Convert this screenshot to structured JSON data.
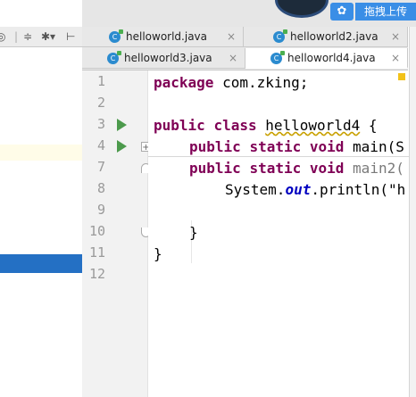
{
  "upload": {
    "label": "拖拽上传"
  },
  "tabs": {
    "row1": [
      {
        "label": "helloworld.java"
      },
      {
        "label": "helloworld2.java"
      }
    ],
    "row2": [
      {
        "label": "helloworld3.java"
      },
      {
        "label": "helloworld4.java",
        "active": true
      }
    ],
    "close_glyph": "×"
  },
  "code": {
    "lines": [
      {
        "number": "1",
        "tokens": [
          "package",
          " com.zking;"
        ]
      },
      {
        "number": "2",
        "tokens": []
      },
      {
        "number": "3",
        "tokens": [
          "public",
          " ",
          "class",
          " ",
          "helloworld4",
          " {"
        ]
      },
      {
        "number": "4",
        "tokens": [
          "public",
          " ",
          "static",
          " ",
          "void",
          " main(S"
        ]
      },
      {
        "number": "7",
        "tokens": [
          "public",
          " ",
          "static",
          " ",
          "void",
          " ",
          "main2("
        ]
      },
      {
        "number": "8",
        "tokens": [
          "System.",
          "out",
          ".println(\"h"
        ]
      },
      {
        "number": "9",
        "tokens": []
      },
      {
        "number": "10",
        "tokens": [
          "}"
        ]
      },
      {
        "number": "11",
        "tokens": [
          "}"
        ]
      },
      {
        "number": "12",
        "tokens": []
      }
    ]
  },
  "icons": {
    "left_toolbar": [
      "target-icon",
      "collapse-icon",
      "gear-icon",
      "pin-icon"
    ],
    "gutter": [
      "run-icon",
      "fold-icon"
    ]
  },
  "colors": {
    "keyword": "#7f0055",
    "string": "#2a00ff",
    "field": "#0000c0",
    "selection": "#2470c4",
    "current_line": "#fffae3"
  }
}
